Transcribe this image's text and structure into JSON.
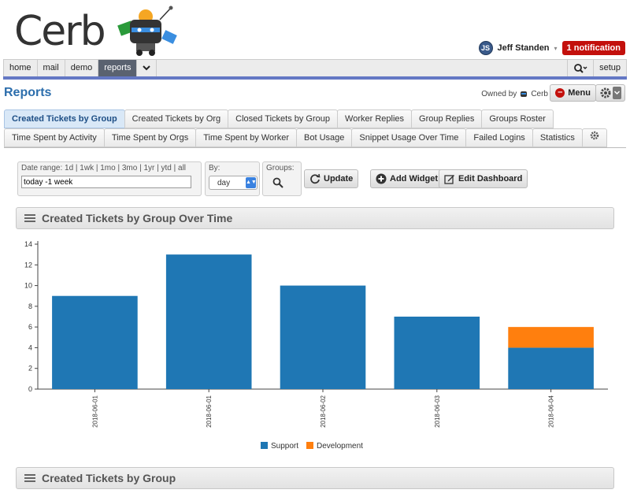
{
  "app": {
    "logo_text": "Cerb"
  },
  "user": {
    "initials": "JS",
    "name": "Jeff Standen",
    "notification": "1 notification"
  },
  "nav": {
    "left": [
      "home",
      "mail",
      "demo",
      "reports"
    ],
    "active": "reports",
    "right_setup": "setup"
  },
  "page": {
    "title": "Reports",
    "owned_by": "Owned by",
    "owner_name": "Cerb",
    "menu_label": "Menu"
  },
  "tabs_row1": [
    "Created Tickets by Group",
    "Created Tickets by Org",
    "Closed Tickets by Group",
    "Worker Replies",
    "Group Replies",
    "Groups Roster"
  ],
  "tabs_row2": [
    "Time Spent by Activity",
    "Time Spent by Orgs",
    "Time Spent by Worker",
    "Bot Usage",
    "Snippet Usage Over Time",
    "Failed Logins",
    "Statistics"
  ],
  "active_tab": "Created Tickets by Group",
  "filters": {
    "date_range_label": "Date range: 1d | 1wk | 1mo | 3mo | 1yr | ytd | all",
    "date_range_value": "today -1 week",
    "by_label": "By:",
    "by_value": "day",
    "groups_label": "Groups:"
  },
  "buttons": {
    "update": "Update",
    "add_widget": "Add Widget",
    "edit_dashboard": "Edit Dashboard"
  },
  "widgets": {
    "chart_title": "Created Tickets by Group Over Time",
    "table_title": "Created Tickets by Group"
  },
  "colors": {
    "support": "#1f77b4",
    "development": "#ff7f0e",
    "accent": "#2c6eac",
    "nav_blue": "#6478c4"
  },
  "chart_data": {
    "type": "bar",
    "stacked": true,
    "categories": [
      "2018-06-01",
      "2018-06-01",
      "2018-06-02",
      "2018-06-03",
      "2018-06-04"
    ],
    "series": [
      {
        "name": "Support",
        "values": [
          9,
          13,
          10,
          7,
          4
        ]
      },
      {
        "name": "Development",
        "values": [
          0,
          0,
          0,
          0,
          2
        ]
      }
    ],
    "yticks": [
      0,
      2,
      4,
      6,
      8,
      10,
      12,
      14
    ],
    "ylim": [
      0,
      14
    ],
    "legend": "bottom",
    "grid": false
  }
}
